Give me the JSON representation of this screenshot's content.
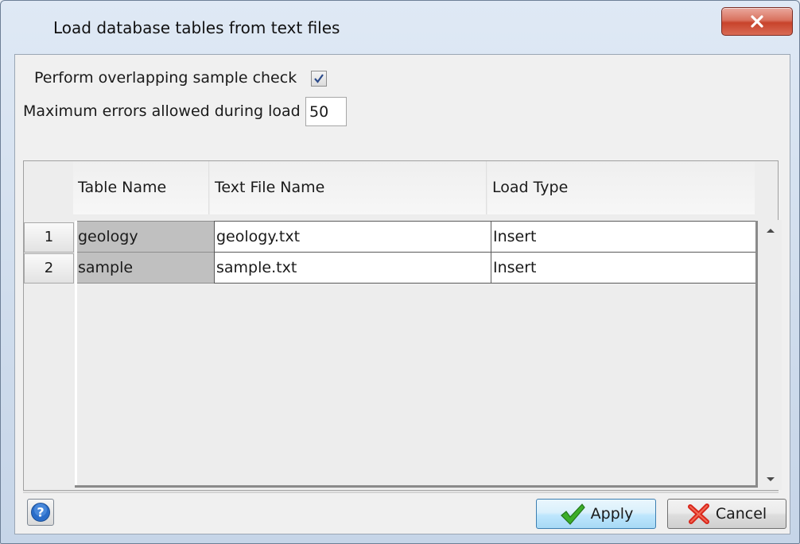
{
  "window": {
    "title": "Load database tables from text files",
    "close_glyph": "X"
  },
  "options": {
    "overlap_check_label": "Perform overlapping sample check",
    "overlap_check_checked": true,
    "max_errors_label": "Maximum errors allowed during load",
    "max_errors_value": "50"
  },
  "table": {
    "columns": [
      "Table Name",
      "Text File Name",
      "Load Type"
    ],
    "rows": [
      {
        "num": "1",
        "table_name": "geology",
        "file_name": "geology.txt",
        "load_type": "Insert"
      },
      {
        "num": "2",
        "table_name": "sample",
        "file_name": "sample.txt",
        "load_type": "Insert"
      }
    ]
  },
  "buttons": {
    "help_icon": "question-mark",
    "apply_label": "Apply",
    "apply_icon": "checkmark",
    "cancel_label": "Cancel",
    "cancel_icon": "red-x"
  },
  "colors": {
    "apply_icon": "#3cae2a",
    "cancel_icon": "#d8261b",
    "help_icon": "#2a6dc9"
  }
}
